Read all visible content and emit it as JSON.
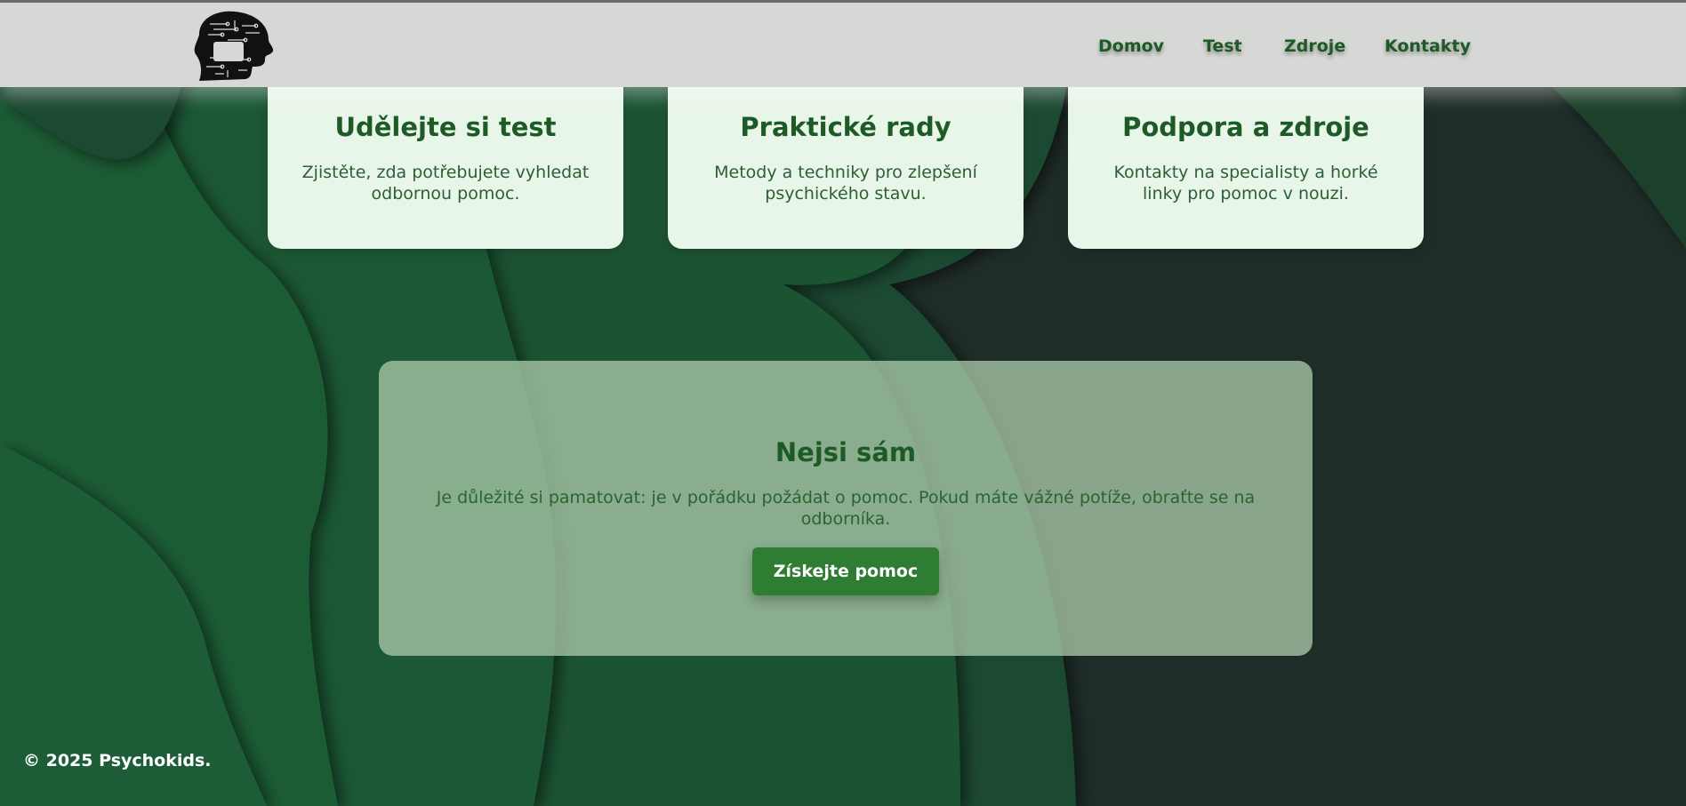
{
  "header": {
    "nav": [
      "Domov",
      "Test",
      "Zdroje",
      "Kontakty"
    ]
  },
  "cards": [
    {
      "title": "Udělejte si test",
      "text": "Zjistěte, zda potřebujete vyhledat odbornou pomoc."
    },
    {
      "title": "Praktické rady",
      "text": "Metody a techniky pro zlepšení psychického stavu."
    },
    {
      "title": "Podpora a zdroje",
      "text": "Kontakty na specialisty a horké linky pro pomoc v nouzi."
    }
  ],
  "panel": {
    "title": "Nejsi sám",
    "text": "Je důležité si pamatovat: je v pořádku požádat o pomoc. Pokud máte vážné potíže, obraťte se na odborníka.",
    "button": "Získejte pomoc"
  },
  "footer": {
    "text": "© 2025 Psychokids."
  },
  "colors": {
    "header_bg": "#d6d8d6",
    "accent_text": "#1e5a26",
    "card_bg": "#e8f5e9",
    "button_bg": "#2e7d32",
    "page_dark": "#1f2d28",
    "wave_green": "#1e5b36"
  },
  "icons": {
    "logo": "head-circuit-logo-icon"
  }
}
